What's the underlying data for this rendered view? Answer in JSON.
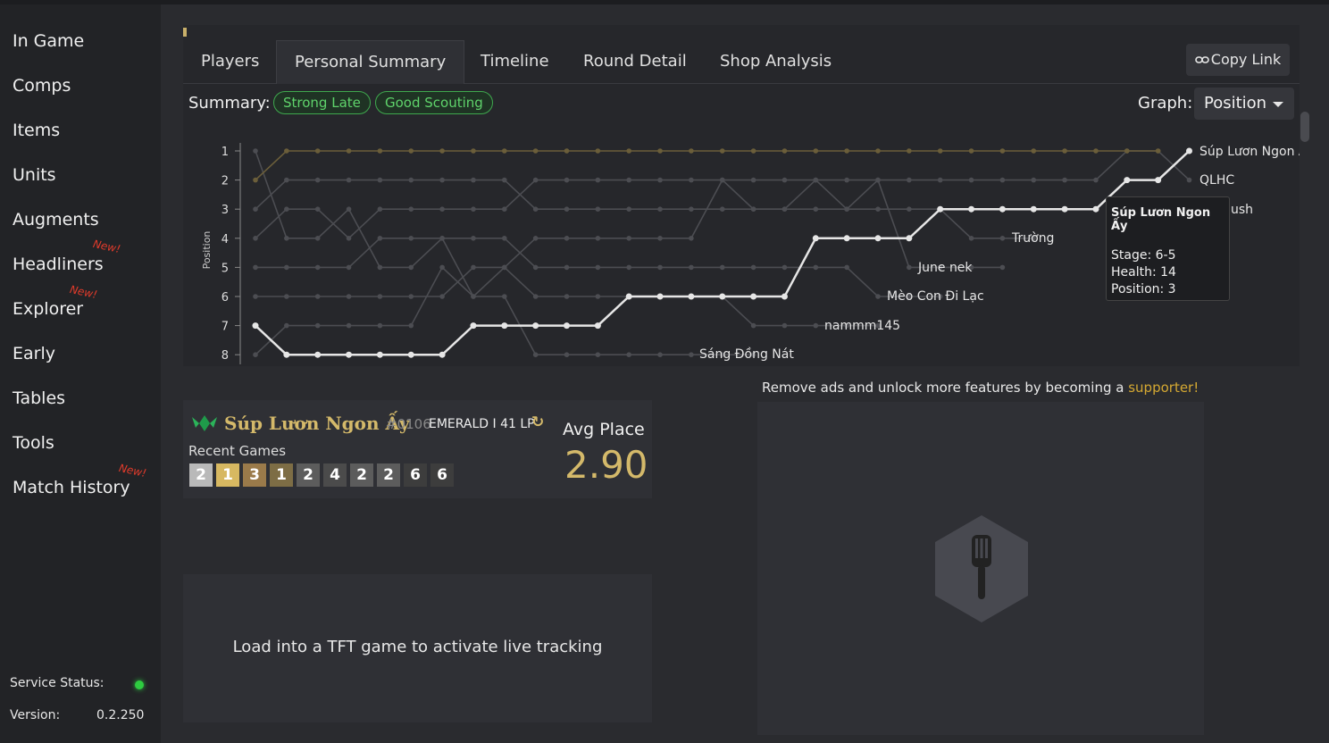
{
  "sidebar": {
    "items": [
      {
        "label": "In Game",
        "new": false
      },
      {
        "label": "Comps",
        "new": false
      },
      {
        "label": "Items",
        "new": false
      },
      {
        "label": "Units",
        "new": false
      },
      {
        "label": "Augments",
        "new": false
      },
      {
        "label": "Headliners",
        "new": true
      },
      {
        "label": "Explorer",
        "new": true
      },
      {
        "label": "Early",
        "new": false
      },
      {
        "label": "Tables",
        "new": false
      },
      {
        "label": "Tools",
        "new": false
      },
      {
        "label": "Match History",
        "new": true
      }
    ],
    "new_label": "New!",
    "service_status_label": "Service Status:",
    "version_label": "Version:",
    "version": "0.2.250"
  },
  "tabs": [
    {
      "label": "Players",
      "active": false
    },
    {
      "label": "Personal Summary",
      "active": true
    },
    {
      "label": "Timeline",
      "active": false
    },
    {
      "label": "Round Detail",
      "active": false
    },
    {
      "label": "Shop Analysis",
      "active": false
    }
  ],
  "copy_link_label": "Copy Link",
  "summary": {
    "label": "Summary:",
    "pills": [
      "Strong Late",
      "Good Scouting"
    ]
  },
  "graph": {
    "label": "Graph:",
    "selected": "Position"
  },
  "chart_data": {
    "type": "line",
    "ylabel": "Position",
    "yticks": [
      1,
      2,
      3,
      4,
      5,
      6,
      7,
      8
    ],
    "ylim": [
      1,
      8
    ],
    "x": [
      1,
      2,
      3,
      4,
      5,
      6,
      7,
      8,
      9,
      10,
      11,
      12,
      13,
      14,
      15,
      16,
      17,
      18,
      19,
      20,
      21,
      22,
      23,
      24,
      25,
      26,
      27,
      28,
      29,
      30,
      31
    ],
    "highlight_color": "#e6e6e6",
    "series": [
      {
        "name": "Súp Lươn Ngon Ấy",
        "highlight": true,
        "values": [
          7,
          8,
          8,
          8,
          8,
          8,
          8,
          7,
          7,
          7,
          7,
          7,
          6,
          6,
          6,
          6,
          6,
          6,
          4,
          4,
          4,
          4,
          3,
          3,
          3,
          3,
          3,
          3,
          2,
          2,
          1
        ]
      },
      {
        "name": "QLHC",
        "values": [
          1,
          4,
          4,
          3,
          5,
          5,
          4,
          6,
          5,
          4,
          4,
          4,
          4,
          4,
          4,
          2,
          3,
          3,
          2,
          3,
          2,
          2,
          2,
          2,
          2,
          2,
          2,
          2,
          1,
          1,
          2
        ]
      },
      {
        "name": "Trường",
        "values": [
          2,
          1,
          1,
          1,
          1,
          1,
          1,
          1,
          1,
          1,
          1,
          1,
          1,
          1,
          1,
          1,
          1,
          1,
          1,
          1,
          1,
          1,
          1,
          1,
          1,
          1,
          1,
          1,
          1,
          1
        ]
      },
      {
        "name": "June nek",
        "values": [
          3,
          2,
          2,
          2,
          2,
          2,
          2,
          2,
          2,
          3,
          3,
          3,
          3,
          3,
          3,
          3,
          3,
          3,
          3,
          3,
          3,
          3,
          3,
          4,
          4,
          4
        ]
      },
      {
        "name": "Mèo Con Đi Lạc",
        "values": [
          4,
          3,
          3,
          4,
          3,
          3,
          3,
          3,
          3,
          2,
          2,
          2,
          2,
          2,
          2,
          2,
          2,
          2,
          2,
          2,
          2,
          5,
          5,
          5,
          5
        ]
      },
      {
        "name": "nammm145",
        "values": [
          5,
          5,
          5,
          5,
          4,
          4,
          4,
          4,
          4,
          5,
          5,
          5,
          5,
          5,
          5,
          5,
          5,
          5,
          5,
          5,
          6,
          6,
          6
        ]
      },
      {
        "name": "Sáng Đồng Nát",
        "values": [
          6,
          6,
          6,
          6,
          6,
          6,
          6,
          5,
          5,
          6,
          6,
          6,
          6,
          6,
          6,
          6,
          7,
          7,
          7,
          7,
          7
        ]
      },
      {
        "name": "",
        "values": [
          8,
          7,
          7,
          7,
          7,
          7,
          5,
          6,
          6,
          8,
          8,
          8,
          8,
          8,
          8,
          8,
          8
        ]
      }
    ],
    "labels": [
      {
        "text": "Súp Lươn Ngon Ấy",
        "position": 1
      },
      {
        "text": "QLHC",
        "position": 2
      },
      {
        "text": "ush",
        "position": 3
      },
      {
        "text": "Trường",
        "position": 4
      },
      {
        "text": "June nek",
        "position": 5
      },
      {
        "text": "Mèo Con Đi Lạc",
        "position": 6
      },
      {
        "text": "nammm145",
        "position": 7
      },
      {
        "text": "Sáng Đồng Nát",
        "position": 8
      }
    ]
  },
  "tooltip": {
    "title": "Súp Lươn Ngon Ấy",
    "stage": "Stage: 6-5",
    "health": "Health: 14",
    "position": "Position: 3"
  },
  "profile": {
    "name": "Súp Lươn Ngon Ấy",
    "tag": "#0106",
    "rank": "EMERALD I 41 LP",
    "refresh_icon": "refresh-icon",
    "recent_label": "Recent Games",
    "recent_games": [
      {
        "place": "2",
        "color": "#b9b9b9"
      },
      {
        "place": "1",
        "color": "#d7b861"
      },
      {
        "place": "3",
        "color": "#9a7a4a"
      },
      {
        "place": "1",
        "color": "#7d6d45"
      },
      {
        "place": "2",
        "color": "#5c5c5c"
      },
      {
        "place": "4",
        "color": "#4b4b4b"
      },
      {
        "place": "2",
        "color": "#5c5c5c"
      },
      {
        "place": "2",
        "color": "#5c5c5c"
      },
      {
        "place": "6",
        "color": "#3d3d3d"
      },
      {
        "place": "6",
        "color": "#3d3d3d"
      }
    ],
    "avg_label": "Avg Place",
    "avg_value": "2.90"
  },
  "live_tracking_text": "Load into a TFT game to activate live tracking",
  "ad": {
    "text": "Remove ads and unlock more features by becoming a ",
    "link": "supporter!"
  }
}
